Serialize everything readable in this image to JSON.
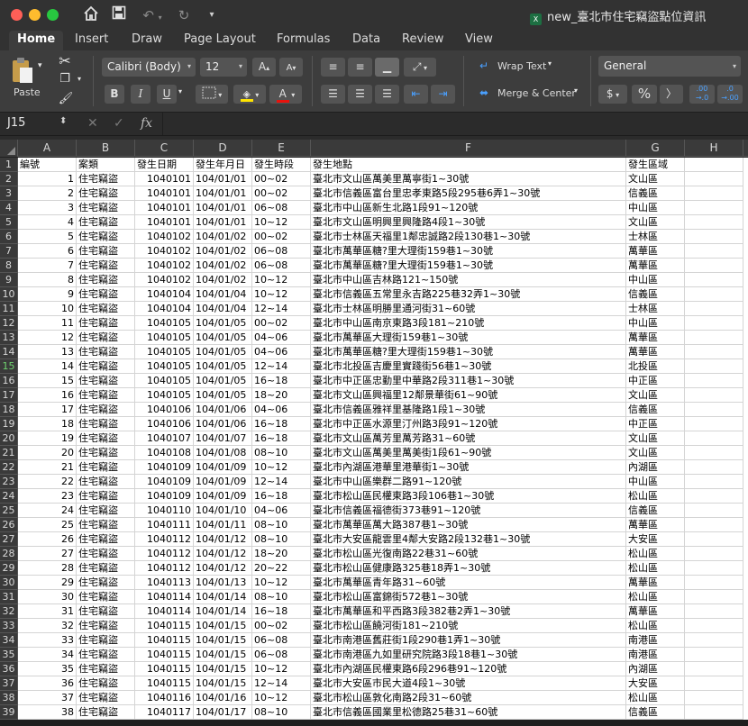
{
  "window": {
    "title": "new_臺北市住宅竊盜點位資訊"
  },
  "quick_access": {
    "home_icon": "home-icon",
    "save_icon": "save-icon",
    "undo_icon": "undo-icon",
    "redo_icon": "redo-icon",
    "customize_icon": "customize-icon"
  },
  "ribbon_tabs": [
    "Home",
    "Insert",
    "Draw",
    "Page Layout",
    "Formulas",
    "Data",
    "Review",
    "View"
  ],
  "active_tab": "Home",
  "ribbon": {
    "paste_label": "Paste",
    "font_name": "Calibri (Body)",
    "font_size": "12",
    "bold": "B",
    "italic": "I",
    "underline": "U",
    "wrap_text": "Wrap Text",
    "merge_center": "Merge & Center",
    "number_format": "General",
    "currency": "$",
    "percent": "%",
    "comma": "〉",
    "inc_decimal": ".00 →.0",
    "dec_decimal": ".0 →.00"
  },
  "formula_bar": {
    "name_box": "J15",
    "cancel": "✕",
    "enter": "✓",
    "fx": "fx",
    "content": ""
  },
  "columns": [
    "A",
    "B",
    "C",
    "D",
    "E",
    "F",
    "G",
    "H"
  ],
  "header_row": [
    "編號",
    "案類",
    "發生日期",
    "發生年月日",
    "發生時段",
    "發生地點",
    "發生區域"
  ],
  "rows": [
    [
      "1",
      "住宅竊盜",
      "1040101",
      "104/01/01",
      "00~02",
      "臺北市文山區萬美里萬寧街1~30號",
      "文山區"
    ],
    [
      "2",
      "住宅竊盜",
      "1040101",
      "104/01/01",
      "00~02",
      "臺北市信義區富台里忠孝東路5段295巷6弄1~30號",
      "信義區"
    ],
    [
      "3",
      "住宅竊盜",
      "1040101",
      "104/01/01",
      "06~08",
      "臺北市中山區新生北路1段91~120號",
      "中山區"
    ],
    [
      "4",
      "住宅竊盜",
      "1040101",
      "104/01/01",
      "10~12",
      "臺北市文山區明興里興隆路4段1~30號",
      "文山區"
    ],
    [
      "5",
      "住宅竊盜",
      "1040102",
      "104/01/02",
      "00~02",
      "臺北市士林區天福里1鄰忠誠路2段130巷1~30號",
      "士林區"
    ],
    [
      "6",
      "住宅竊盜",
      "1040102",
      "104/01/02",
      "06~08",
      "臺北市萬華區糖?里大理街159巷1~30號",
      "萬華區"
    ],
    [
      "7",
      "住宅竊盜",
      "1040102",
      "104/01/02",
      "06~08",
      "臺北市萬華區糖?里大理街159巷1~30號",
      "萬華區"
    ],
    [
      "8",
      "住宅竊盜",
      "1040102",
      "104/01/02",
      "10~12",
      "臺北市中山區吉林路121~150號",
      "中山區"
    ],
    [
      "9",
      "住宅竊盜",
      "1040104",
      "104/01/04",
      "10~12",
      "臺北市信義區五常里永吉路225巷32弄1~30號",
      "信義區"
    ],
    [
      "10",
      "住宅竊盜",
      "1040104",
      "104/01/04",
      "12~14",
      "臺北市士林區明勝里通河街31~60號",
      "士林區"
    ],
    [
      "11",
      "住宅竊盜",
      "1040105",
      "104/01/05",
      "00~02",
      "臺北市中山區南京東路3段181~210號",
      "中山區"
    ],
    [
      "12",
      "住宅竊盜",
      "1040105",
      "104/01/05",
      "04~06",
      "臺北市萬華區大理街159巷1~30號",
      "萬華區"
    ],
    [
      "13",
      "住宅竊盜",
      "1040105",
      "104/01/05",
      "04~06",
      "臺北市萬華區糖?里大理街159巷1~30號",
      "萬華區"
    ],
    [
      "14",
      "住宅竊盜",
      "1040105",
      "104/01/05",
      "12~14",
      "臺北市北投區吉慶里實踐街56巷1~30號",
      "北投區"
    ],
    [
      "15",
      "住宅竊盜",
      "1040105",
      "104/01/05",
      "16~18",
      "臺北市中正區忠勤里中華路2段311巷1~30號",
      "中正區"
    ],
    [
      "16",
      "住宅竊盜",
      "1040105",
      "104/01/05",
      "18~20",
      "臺北市文山區興福里12鄰景華街61~90號",
      "文山區"
    ],
    [
      "17",
      "住宅竊盜",
      "1040106",
      "104/01/06",
      "04~06",
      "臺北市信義區雅祥里基隆路1段1~30號",
      "信義區"
    ],
    [
      "18",
      "住宅竊盜",
      "1040106",
      "104/01/06",
      "16~18",
      "臺北市中正區水源里汀州路3段91~120號",
      "中正區"
    ],
    [
      "19",
      "住宅竊盜",
      "1040107",
      "104/01/07",
      "16~18",
      "臺北市文山區萬芳里萬芳路31~60號",
      "文山區"
    ],
    [
      "20",
      "住宅竊盜",
      "1040108",
      "104/01/08",
      "08~10",
      "臺北市文山區萬美里萬美街1段61~90號",
      "文山區"
    ],
    [
      "21",
      "住宅竊盜",
      "1040109",
      "104/01/09",
      "10~12",
      "臺北市內湖區港華里港華街1~30號",
      "內湖區"
    ],
    [
      "22",
      "住宅竊盜",
      "1040109",
      "104/01/09",
      "12~14",
      "臺北市中山區樂群二路91~120號",
      "中山區"
    ],
    [
      "23",
      "住宅竊盜",
      "1040109",
      "104/01/09",
      "16~18",
      "臺北市松山區民權東路3段106巷1~30號",
      "松山區"
    ],
    [
      "24",
      "住宅竊盜",
      "1040110",
      "104/01/10",
      "04~06",
      "臺北市信義區福德街373巷91~120號",
      "信義區"
    ],
    [
      "25",
      "住宅竊盜",
      "1040111",
      "104/01/11",
      "08~10",
      "臺北市萬華區萬大路387巷1~30號",
      "萬華區"
    ],
    [
      "26",
      "住宅竊盜",
      "1040112",
      "104/01/12",
      "08~10",
      "臺北市大安區龍雲里4鄰大安路2段132巷1~30號",
      "大安區"
    ],
    [
      "27",
      "住宅竊盜",
      "1040112",
      "104/01/12",
      "18~20",
      "臺北市松山區光復南路22巷31~60號",
      "松山區"
    ],
    [
      "28",
      "住宅竊盜",
      "1040112",
      "104/01/12",
      "20~22",
      "臺北市松山區健康路325巷18弄1~30號",
      "松山區"
    ],
    [
      "29",
      "住宅竊盜",
      "1040113",
      "104/01/13",
      "10~12",
      "臺北市萬華區青年路31~60號",
      "萬華區"
    ],
    [
      "30",
      "住宅竊盜",
      "1040114",
      "104/01/14",
      "08~10",
      "臺北市松山區富錦街572巷1~30號",
      "松山區"
    ],
    [
      "31",
      "住宅竊盜",
      "1040114",
      "104/01/14",
      "16~18",
      "臺北市萬華區和平西路3段382巷2弄1~30號",
      "萬華區"
    ],
    [
      "32",
      "住宅竊盜",
      "1040115",
      "104/01/15",
      "00~02",
      "臺北市松山區饒河街181~210號",
      "松山區"
    ],
    [
      "33",
      "住宅竊盜",
      "1040115",
      "104/01/15",
      "06~08",
      "臺北市南港區舊莊街1段290巷1弄1~30號",
      "南港區"
    ],
    [
      "34",
      "住宅竊盜",
      "1040115",
      "104/01/15",
      "06~08",
      "臺北市南港區九如里研究院路3段18巷1~30號",
      "南港區"
    ],
    [
      "35",
      "住宅竊盜",
      "1040115",
      "104/01/15",
      "10~12",
      "臺北市內湖區民權東路6段296巷91~120號",
      "內湖區"
    ],
    [
      "36",
      "住宅竊盜",
      "1040115",
      "104/01/15",
      "12~14",
      "臺北市大安區市民大道4段1~30號",
      "大安區"
    ],
    [
      "37",
      "住宅竊盜",
      "1040116",
      "104/01/16",
      "10~12",
      "臺北市松山區敦化南路2段31~60號",
      "松山區"
    ],
    [
      "38",
      "住宅竊盜",
      "1040117",
      "104/01/17",
      "08~10",
      "臺北市信義區國業里松德路25巷31~60號",
      "信義區"
    ]
  ],
  "selected_row": 15
}
